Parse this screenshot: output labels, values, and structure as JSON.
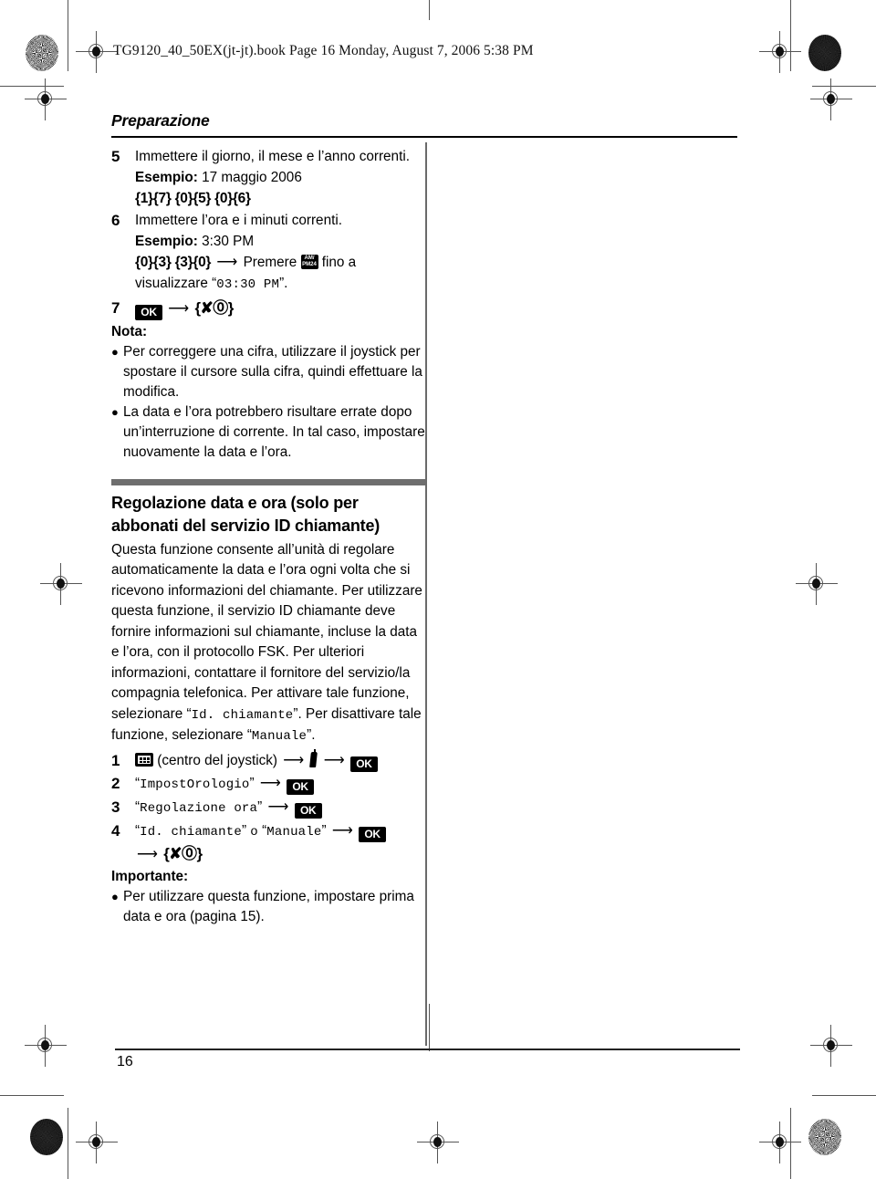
{
  "header": {
    "text": "TG9120_40_50EX(jt-jt).book  Page 16  Monday, August 7, 2006  5:38 PM"
  },
  "chapter": {
    "title": "Preparazione"
  },
  "steps_continued": [
    {
      "num": "5",
      "line1": "Immettere il giorno, il mese e l’anno correnti.",
      "example_label": "Esempio:",
      "example_value": "17 maggio 2006",
      "keys": "{1}{7} {0}{5} {0}{6}"
    },
    {
      "num": "6",
      "line1": "Immettere l’ora e i minuti correnti.",
      "example_label": "Esempio:",
      "example_value": "3:30 PM",
      "keys": "{0}{3} {3}{0}",
      "press_word": "Premere",
      "ampm_icon": "am-pm-24-key-icon",
      "after_icon": "fino a",
      "display_prefix": "visualizzare “",
      "display_value": "03:30  PM",
      "display_suffix": "”."
    },
    {
      "num": "7",
      "ok_icon": "ok-key-icon",
      "power_key": "{✘⓪}"
    }
  ],
  "note": {
    "label": "Nota:",
    "items": [
      "Per correggere una cifra, utilizzare il joystick per spostare il cursore sulla cifra, quindi effettuare la modifica.",
      "La data e l’ora potrebbero risultare errate dopo un’interruzione di corrente. In tal caso, impostare nuovamente la data e l’ora."
    ]
  },
  "section": {
    "title_line1": "Regolazione data e ora (solo per",
    "title_line2": "abbonati del servizio ID chiamante)",
    "paragraph_part1": "Questa funzione consente all’unità di regolare automaticamente la data e l’ora ogni volta che si ricevono informazioni del chiamante. Per utilizzare questa funzione, il servizio ID chiamante deve fornire informazioni sul chiamante, incluse la data e l’ora, con il protocollo FSK. Per ulteriori informazioni, contattare il fornitore del servizio/la compagnia telefonica. Per attivare tale funzione, selezionare “",
    "mono_value1": "Id. chiamante",
    "paragraph_part2": "”. Per disattivare tale funzione, selezionare “",
    "mono_value2": "Manuale",
    "paragraph_part3": "”."
  },
  "procedure_steps": [
    {
      "num": "1",
      "joystick_icon": "joystick-center-key-icon",
      "label": "(centro del joystick)",
      "phone_icon": "handset-icon",
      "ok_icon": "ok-key-icon"
    },
    {
      "num": "2",
      "menu_value": "ImpostOrologio",
      "ok_icon": "ok-key-icon"
    },
    {
      "num": "3",
      "menu_value": "Regolazione ora",
      "ok_icon": "ok-key-icon"
    },
    {
      "num": "4",
      "menu_value_a": "Id. chiamante",
      "conjunction": "o",
      "menu_value_b": "Manuale",
      "ok_icon": "ok-key-icon",
      "power_key": "{✘⓪}"
    }
  ],
  "important": {
    "label": "Importante:",
    "items": [
      "Per utilizzare questa funzione, impostare prima data e ora (pagina 15)."
    ]
  },
  "footer": {
    "page_number": "16"
  },
  "icons": {
    "ampm_line1": "AM/",
    "ampm_line2": "PM24",
    "ok_label": "OK"
  },
  "colors": {
    "section_bar": "#6e6e6e",
    "divider": "#6a6a6a",
    "text": "#000000"
  }
}
